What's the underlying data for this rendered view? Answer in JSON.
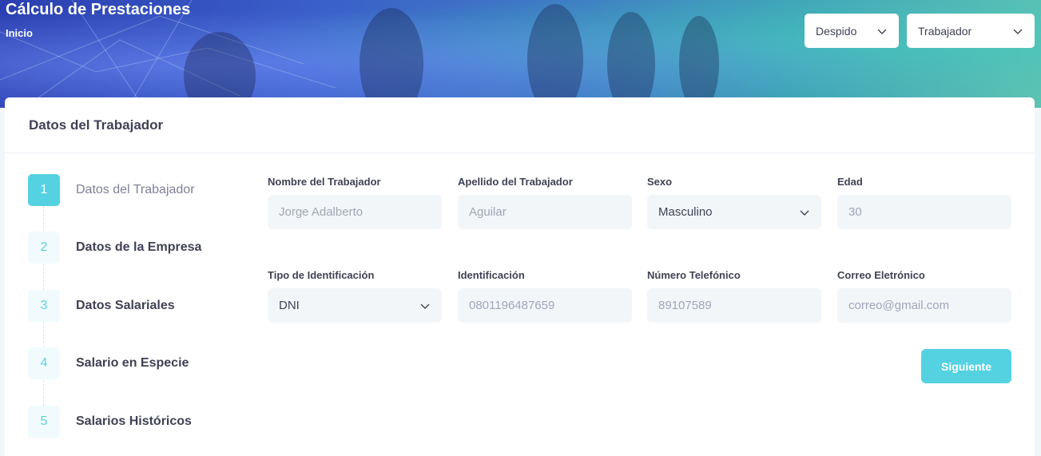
{
  "header": {
    "title": "Cálculo de Prestaciones",
    "breadcrumb": "Inicio",
    "select_case": "Despido",
    "select_role": "Trabajador"
  },
  "card": {
    "title": "Datos del Trabajador"
  },
  "stepper": {
    "steps": [
      {
        "num": "1",
        "label": "Datos del Trabajador"
      },
      {
        "num": "2",
        "label": "Datos de la Empresa"
      },
      {
        "num": "3",
        "label": "Datos Salariales"
      },
      {
        "num": "4",
        "label": "Salario en Especie"
      },
      {
        "num": "5",
        "label": "Salarios Históricos"
      }
    ]
  },
  "form": {
    "first_name": {
      "label": "Nombre del Trabajador",
      "placeholder": "Jorge Adalberto"
    },
    "last_name": {
      "label": "Apellido del Trabajador",
      "placeholder": "Aguilar"
    },
    "sex": {
      "label": "Sexo",
      "value": "Masculino"
    },
    "age": {
      "label": "Edad",
      "placeholder": "30"
    },
    "id_type": {
      "label": "Tipo de Identificación",
      "value": "DNI"
    },
    "id_number": {
      "label": "Identificación",
      "placeholder": "0801196487659"
    },
    "phone": {
      "label": "Número Telefónico",
      "placeholder": "89107589"
    },
    "email": {
      "label": "Correo Eletrónico",
      "placeholder": "correo@gmail.com"
    },
    "next_label": "Siguiente"
  },
  "colors": {
    "accent": "#55d2e2",
    "text": "#3f4254",
    "muted": "#a1a5b7",
    "input_bg": "#f3f6f9"
  }
}
